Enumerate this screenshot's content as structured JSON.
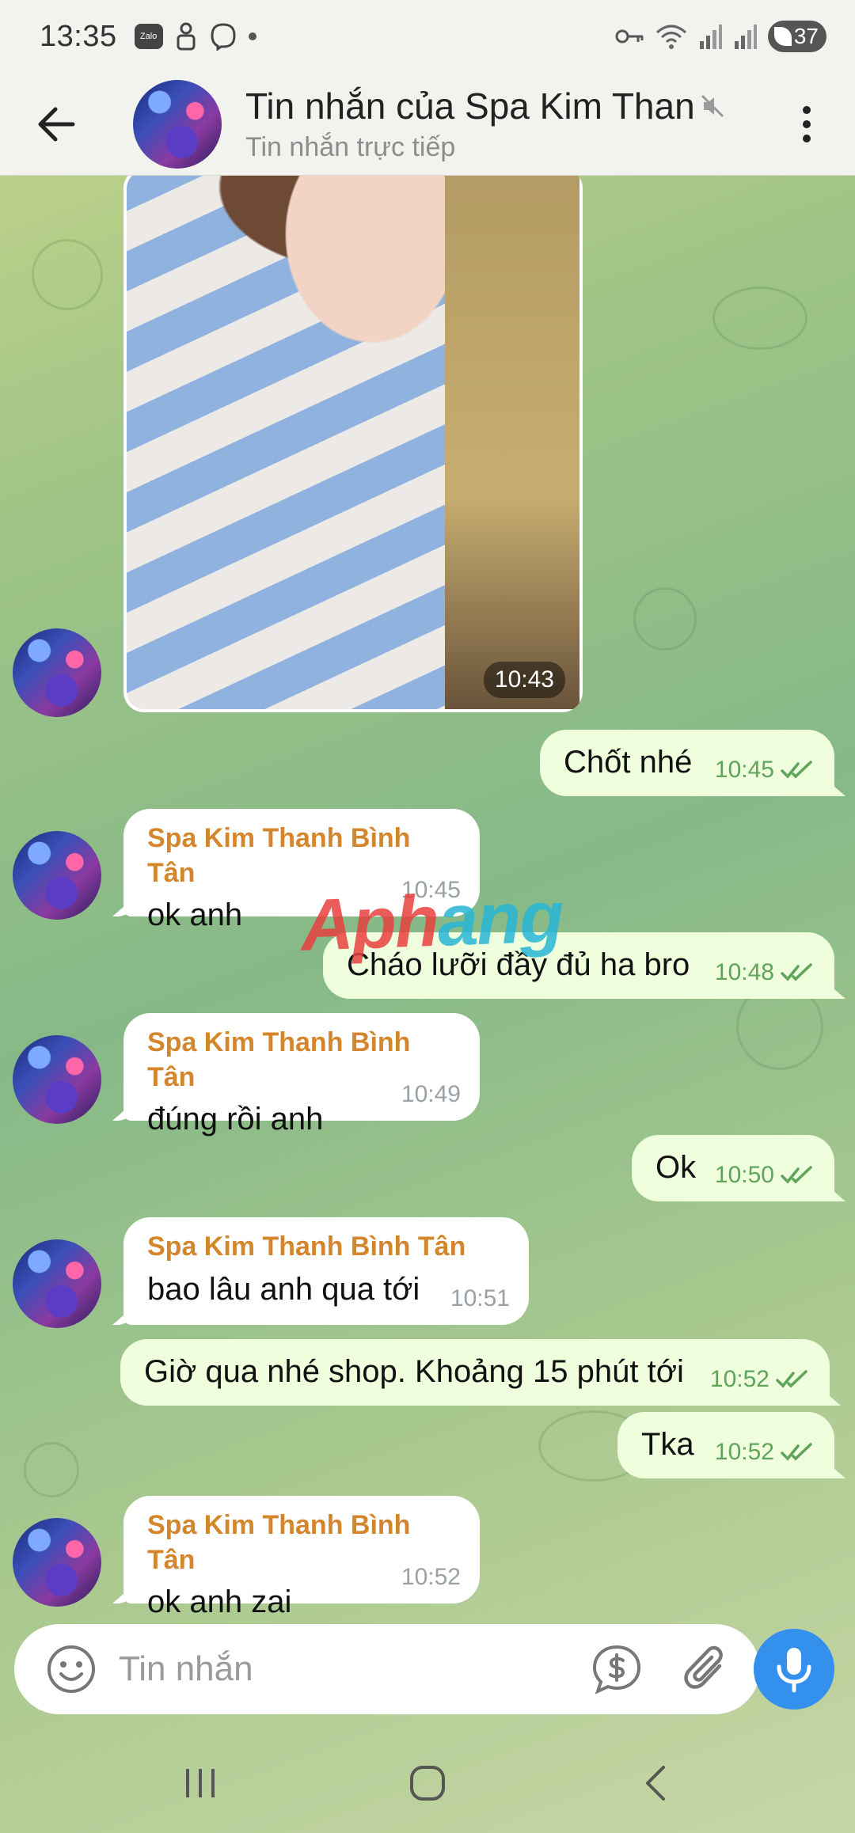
{
  "status_bar": {
    "time": "13:35",
    "app_badge": "Zalo",
    "battery": "37"
  },
  "header": {
    "title": "Tin nhắn của Spa Kim Thanh Bình Tân",
    "subtitle": "Tin nhắn trực tiếp"
  },
  "photo_message": {
    "time": "10:43"
  },
  "messages": [
    {
      "direction": "out",
      "text": "Chốt nhé",
      "time": "10:45",
      "status": "read"
    },
    {
      "direction": "in",
      "sender": "Spa Kim Thanh Bình Tân",
      "text": "ok anh",
      "time": "10:45"
    },
    {
      "direction": "out",
      "text": "Cháo lưỡi đầy đủ ha bro",
      "time": "10:48",
      "status": "read"
    },
    {
      "direction": "in",
      "sender": "Spa Kim Thanh Bình Tân",
      "text": "đúng rồi anh",
      "time": "10:49"
    },
    {
      "direction": "out",
      "text": "Ok",
      "time": "10:50",
      "status": "read"
    },
    {
      "direction": "in",
      "sender": "Spa Kim Thanh Bình Tân",
      "text": "bao lâu anh qua tới",
      "time": "10:51"
    },
    {
      "direction": "out",
      "text": "Giờ qua nhé shop. Khoảng 15 phút tới",
      "time": "10:52",
      "status": "read"
    },
    {
      "direction": "out",
      "text": "Tka",
      "time": "10:52",
      "status": "read"
    },
    {
      "direction": "in",
      "sender": "Spa Kim Thanh Bình Tân",
      "text": "ok anh zai",
      "time": "10:52"
    }
  ],
  "watermark": {
    "part1": "Aph",
    "part2": "ang"
  },
  "input": {
    "placeholder": "Tin nhắn",
    "value": ""
  },
  "colors": {
    "sender_name": "#d3862c",
    "outgoing_bubble": "#effedd",
    "read_check": "#5fa45a",
    "accent": "#3390ec"
  },
  "icons": {
    "back": "arrow-left-icon",
    "muted": "speaker-muted-icon",
    "more": "more-vertical-icon",
    "emoji": "emoji-icon",
    "money": "dollar-chat-icon",
    "attach": "paperclip-icon",
    "mic": "microphone-icon"
  }
}
